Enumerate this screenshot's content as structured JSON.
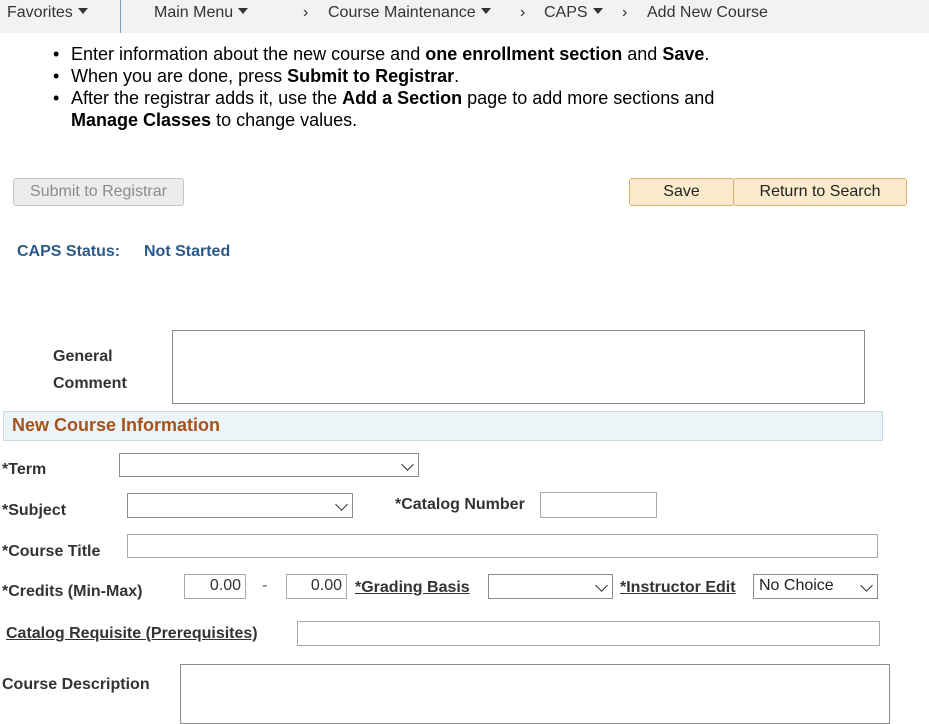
{
  "nav": {
    "favorites": "Favorites",
    "main_menu": "Main Menu",
    "breadcrumb": [
      "Course Maintenance",
      "CAPS",
      "Add New Course"
    ]
  },
  "instructions": {
    "line1_a": "Enter information about the new course and ",
    "line1_b": "one enrollment section",
    "line1_c": " and ",
    "line1_d": "Save",
    "line1_e": ".",
    "line2_a": "When you are done, press ",
    "line2_b": "Submit to Registrar",
    "line2_c": ".",
    "line3_a": "After the registrar adds it, use the ",
    "line3_b": "Add a Section",
    "line3_c": " page to add more sections and",
    "line4_a": "Manage Classes",
    "line4_b": " to change values."
  },
  "buttons": {
    "submit": "Submit to Registrar",
    "save": "Save",
    "return": "Return to Search"
  },
  "status": {
    "label": "CAPS Status:",
    "value": "Not Started"
  },
  "comment": {
    "label_1": "General",
    "label_2": "Comment",
    "value": ""
  },
  "section": {
    "title": "New Course Information"
  },
  "form": {
    "term_label": "*Term",
    "term_value": "",
    "subject_label": "*Subject",
    "subject_value": "",
    "catalog_number_label": "*Catalog Number",
    "catalog_number_value": "",
    "course_title_label": "*Course Title",
    "course_title_value": "",
    "credits_label": "*Credits (Min-Max)",
    "credits_min": "0.00",
    "credits_sep": "-",
    "credits_max": "0.00",
    "grading_basis_label": "*Grading Basis",
    "grading_basis_value": "",
    "instructor_edit_label": "*Instructor Edit",
    "instructor_edit_value": "No Choice",
    "requisite_label": "Catalog Requisite (Prerequisites)",
    "requisite_value": "",
    "description_label": "Course Description",
    "description_value": ""
  }
}
